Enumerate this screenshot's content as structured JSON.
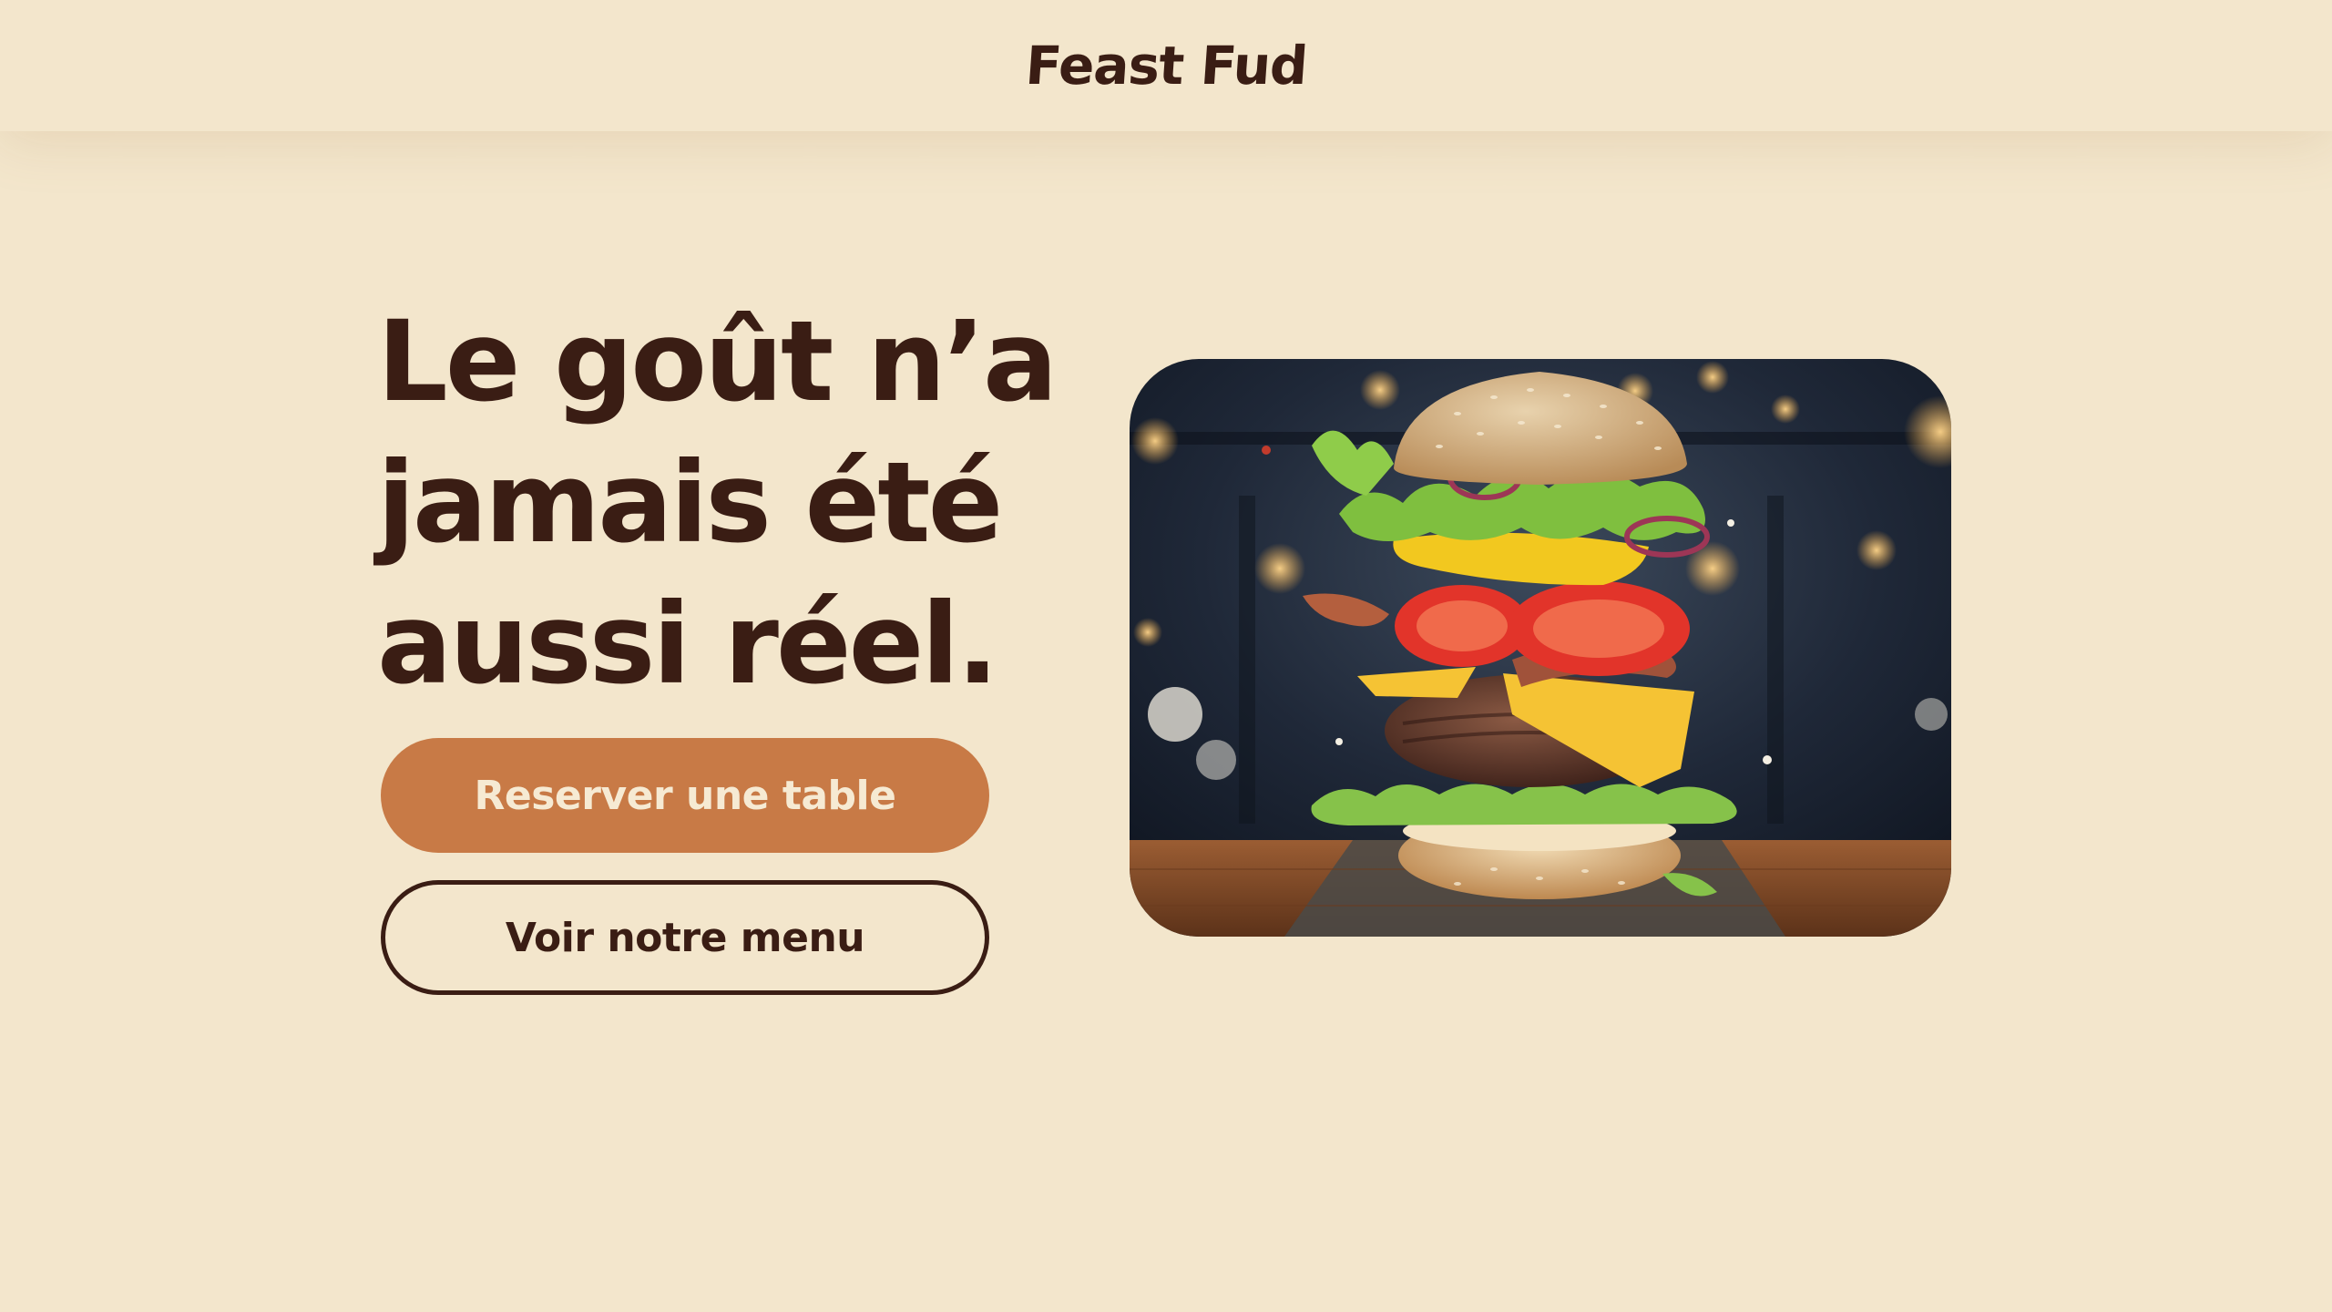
{
  "header": {
    "brand_name": "Feast Fud"
  },
  "hero": {
    "headline": "Le goût n’a jamais été aussi réel.",
    "primary_button": "Reserver une table",
    "secondary_button": "Voir notre menu",
    "image": {
      "subject": "exploded burger with floating ingredients",
      "icon": "burger-photo"
    }
  },
  "colors": {
    "background": "#f3e6cc",
    "text": "#3a1d14",
    "accent": "#c87a46",
    "accent_text": "#f6ead3"
  }
}
